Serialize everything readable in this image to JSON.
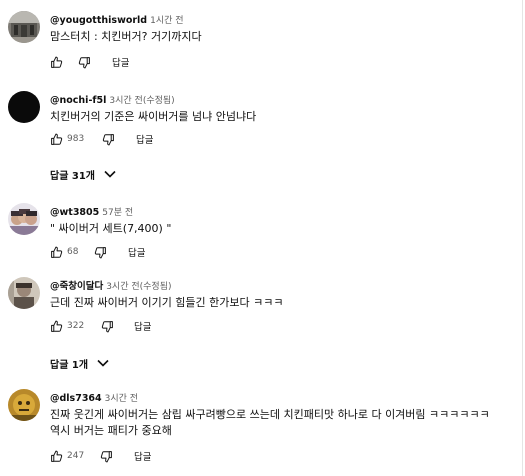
{
  "comments": [
    {
      "handle": "@yougotthisworld",
      "time": "1시간 전",
      "text": "맘스터치 : 치킨버거? 거기까지다",
      "likes": "",
      "reply_label": "답글"
    },
    {
      "handle": "@nochi-f5l",
      "time": "3시간 전(수정됨)",
      "text": "치킨버거의 기준은 싸이버거를 넘냐 안넘냐다",
      "likes": "983",
      "reply_label": "답글",
      "replies_label": "답글 31개"
    },
    {
      "handle": "@wt3805",
      "time": "57분 전",
      "text": "\" 싸이버거 세트(7,400) \"",
      "likes": "68",
      "reply_label": "답글"
    },
    {
      "handle": "@죽창이달다",
      "time": "3시간 전(수정됨)",
      "text": "근데 진짜 싸이버거 이기기 힘들긴 한가보다 ㅋㅋㅋ",
      "likes": "322",
      "reply_label": "답글",
      "replies_label": "답글 1개"
    },
    {
      "handle": "@dls7364",
      "time": "3시간 전",
      "text_line1": "진짜 웃긴게 싸이버거는 삼립 싸구려빵으로 쓰는데 치킨패티맛 하나로 다 이겨버림 ㅋㅋㅋㅋㅋㅋ",
      "text_line2": "역시 버거는 패티가 중요해",
      "likes": "247",
      "reply_label": "답글"
    }
  ],
  "icons": {
    "like": "thumb-up-icon",
    "dislike": "thumb-down-icon",
    "expand": "chevron-down-icon"
  },
  "colors": {
    "text_primary": "#0f0f0f",
    "text_secondary": "#606060"
  }
}
